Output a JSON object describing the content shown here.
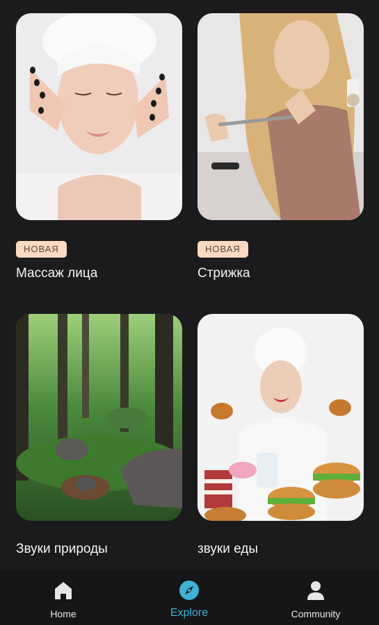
{
  "cards": [
    {
      "badge": "НОВАЯ",
      "title": "Массаж лица",
      "image": "woman-face-massage-photo"
    },
    {
      "badge": "НОВАЯ",
      "title": "Стрижка",
      "image": "hair-cutting-photo"
    },
    {
      "badge": "",
      "title": "Звуки природы",
      "image": "mossy-forest-photo"
    },
    {
      "badge": "",
      "title": "звуки еды",
      "image": "woman-with-fast-food-photo"
    }
  ],
  "nav": {
    "home": {
      "label": "Home",
      "icon": "home-icon"
    },
    "explore": {
      "label": "Explore",
      "icon": "compass-icon"
    },
    "community": {
      "label": "Community",
      "icon": "user-icon"
    }
  },
  "colors": {
    "background": "#1b1b1d",
    "badge_bg": "#fbd9c3",
    "accent": "#3fb3d5"
  }
}
